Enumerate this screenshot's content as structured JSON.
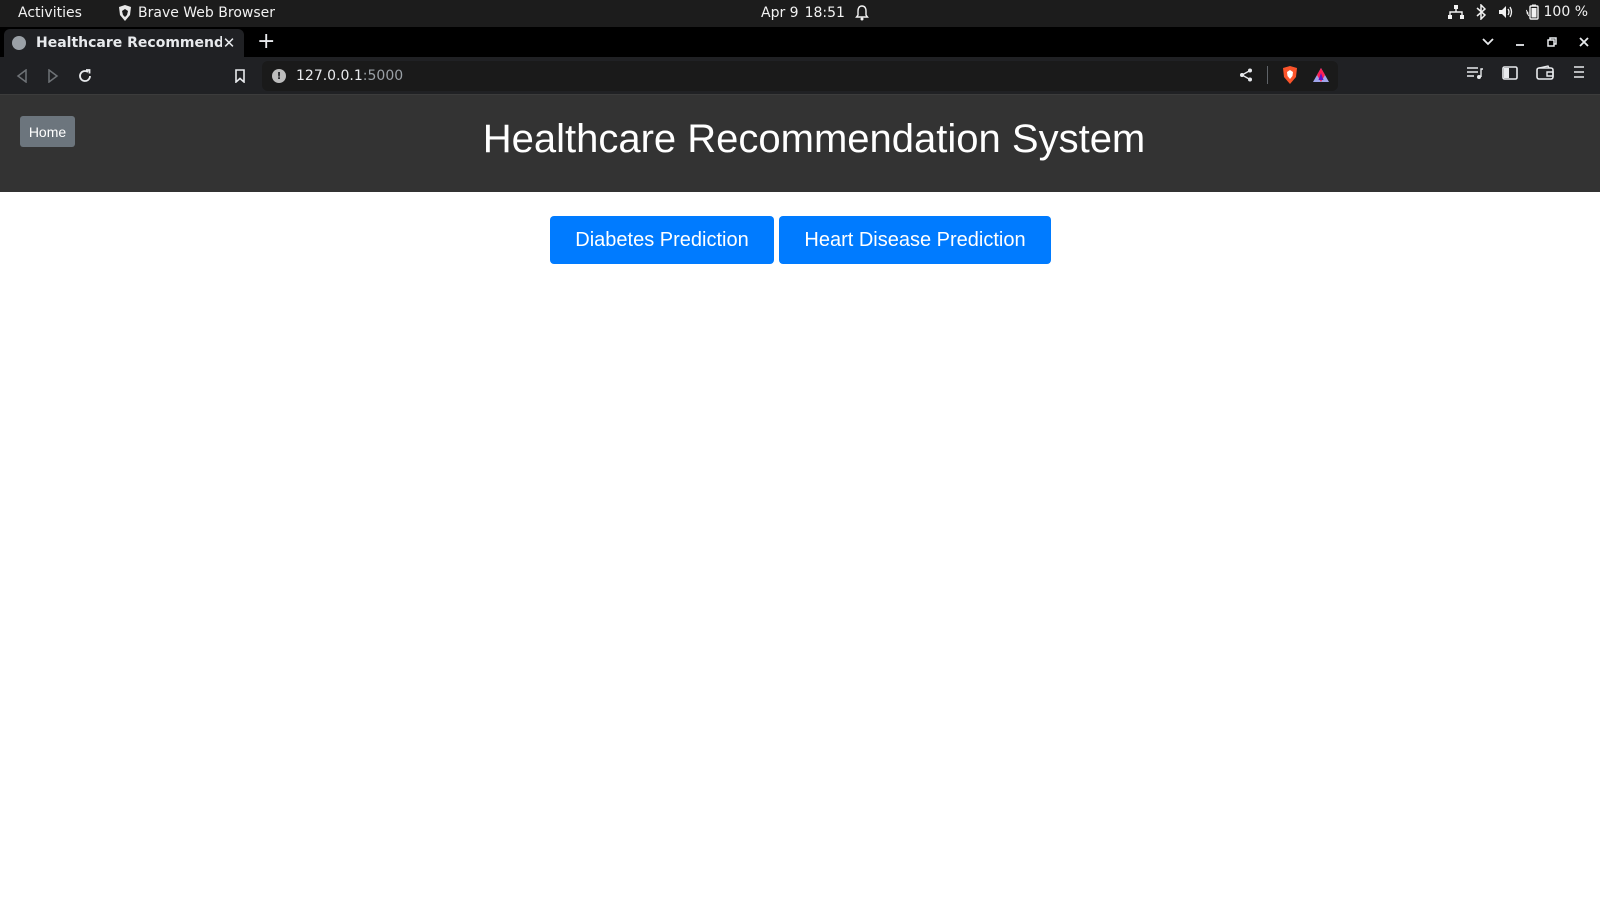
{
  "system_bar": {
    "activities": "Activities",
    "app_name": "Brave Web Browser",
    "date": "Apr 9",
    "time": "18:51",
    "battery": "100 %"
  },
  "browser": {
    "tab_title": "Healthcare Recommendat",
    "url_host": "127.0.0.1",
    "url_port": ":5000"
  },
  "page": {
    "home_button": "Home",
    "title": "Healthcare Recommendation System",
    "buttons": {
      "diabetes": "Diabetes Prediction",
      "heart": "Heart Disease Prediction"
    }
  },
  "colors": {
    "header_bg": "#333333",
    "home_button_bg": "#6c757d",
    "primary_button_bg": "#007bff"
  }
}
